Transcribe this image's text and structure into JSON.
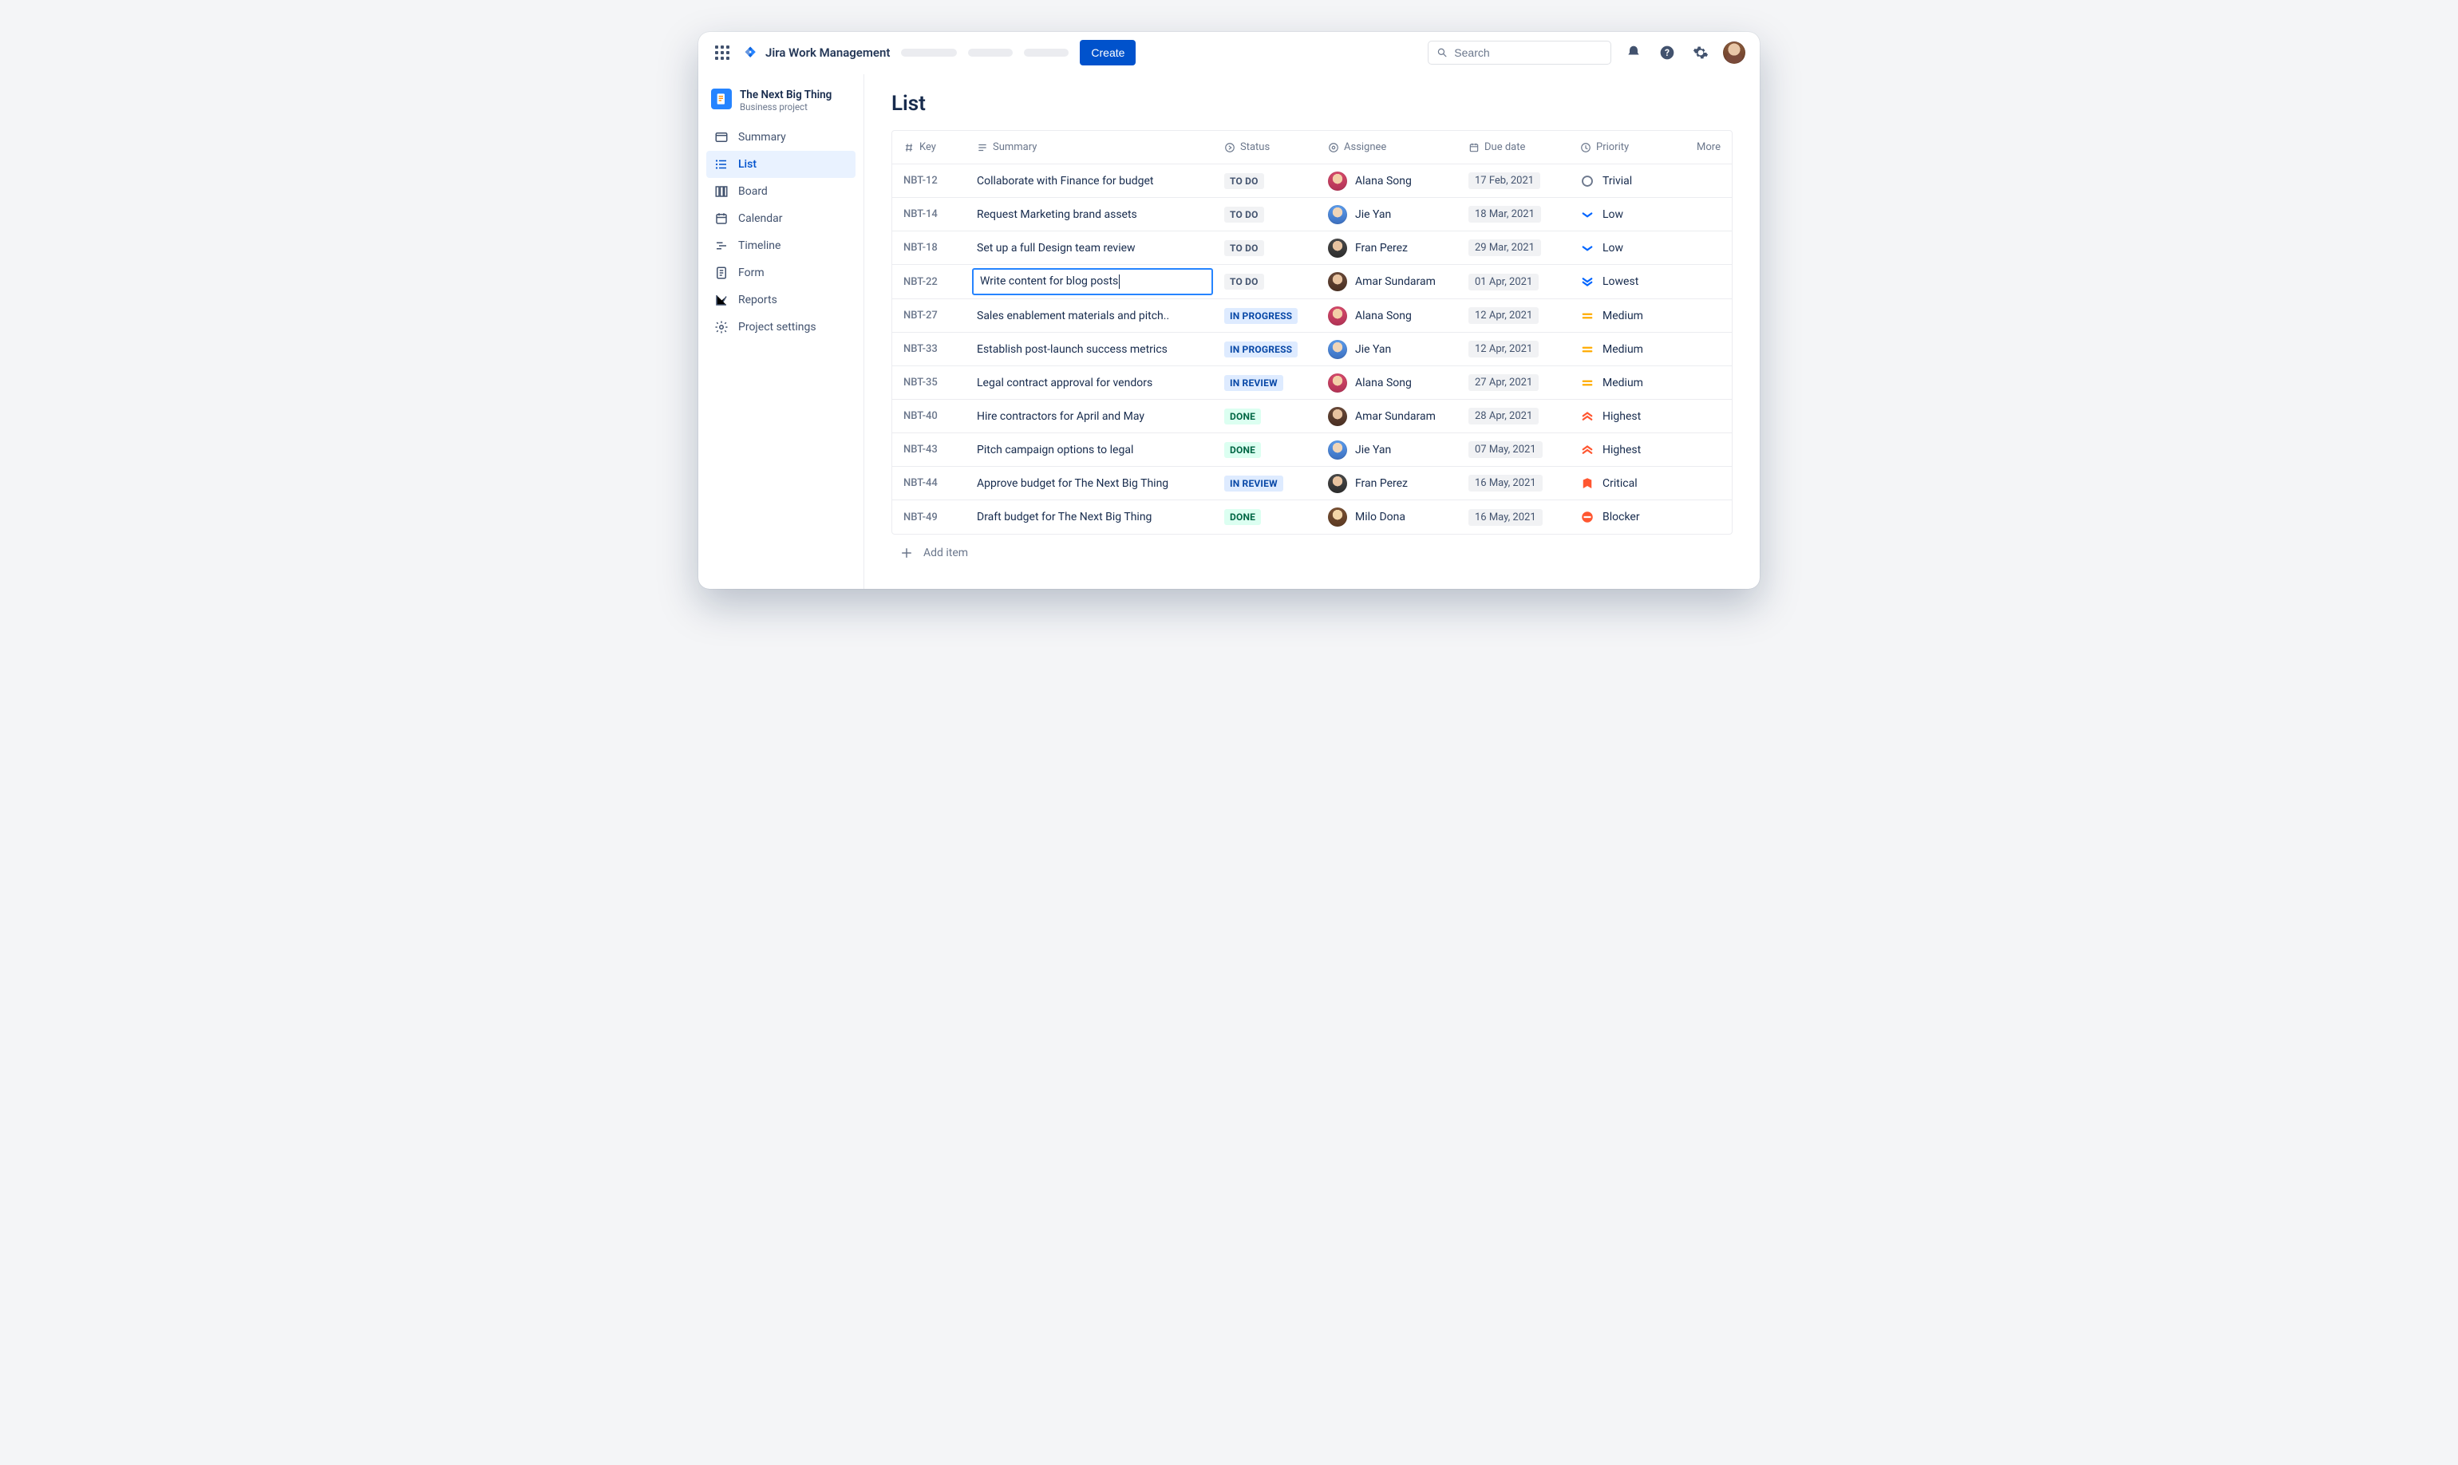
{
  "header": {
    "product": "Jira Work Management",
    "create_label": "Create",
    "search_placeholder": "Search"
  },
  "project": {
    "name": "The Next Big Thing",
    "type": "Business project"
  },
  "sidebar": {
    "items": [
      {
        "label": "Summary",
        "icon": "summary"
      },
      {
        "label": "List",
        "icon": "list",
        "active": true
      },
      {
        "label": "Board",
        "icon": "board"
      },
      {
        "label": "Calendar",
        "icon": "calendar"
      },
      {
        "label": "Timeline",
        "icon": "timeline"
      },
      {
        "label": "Form",
        "icon": "form"
      },
      {
        "label": "Reports",
        "icon": "reports"
      },
      {
        "label": "Project settings",
        "icon": "settings"
      }
    ]
  },
  "page": {
    "title": "List",
    "add_item": "Add item"
  },
  "columns": {
    "key": "Key",
    "summary": "Summary",
    "status": "Status",
    "assignee": "Assignee",
    "due": "Due date",
    "priority": "Priority",
    "more": "More"
  },
  "statuses": {
    "todo": "TO DO",
    "progress": "IN PROGRESS",
    "review": "IN REVIEW",
    "done": "DONE"
  },
  "priorities": {
    "trivial": "Trivial",
    "low": "Low",
    "lowest": "Lowest",
    "medium": "Medium",
    "highest": "Highest",
    "critical": "Critical",
    "blocker": "Blocker"
  },
  "rows": [
    {
      "key": "NBT-12",
      "summary": "Collaborate with Finance for budget",
      "status": "todo",
      "assignee": "Alana Song",
      "avatar": "a",
      "due": "17 Feb, 2021",
      "priority": "trivial"
    },
    {
      "key": "NBT-14",
      "summary": "Request Marketing brand assets",
      "status": "todo",
      "assignee": "Jie Yan",
      "avatar": "b",
      "due": "18 Mar, 2021",
      "priority": "low"
    },
    {
      "key": "NBT-18",
      "summary": "Set up a full Design team review",
      "status": "todo",
      "assignee": "Fran Perez",
      "avatar": "c",
      "due": "29 Mar, 2021",
      "priority": "low"
    },
    {
      "key": "NBT-22",
      "summary": "Write content for blog posts",
      "status": "todo",
      "assignee": "Amar Sundaram",
      "avatar": "d",
      "due": "01 Apr, 2021",
      "priority": "lowest",
      "editing": true
    },
    {
      "key": "NBT-27",
      "summary": "Sales enablement materials and pitch..",
      "status": "progress",
      "assignee": "Alana Song",
      "avatar": "a",
      "due": "12 Apr, 2021",
      "priority": "medium"
    },
    {
      "key": "NBT-33",
      "summary": "Establish post-launch success metrics",
      "status": "progress",
      "assignee": "Jie Yan",
      "avatar": "b",
      "due": "12 Apr, 2021",
      "priority": "medium"
    },
    {
      "key": "NBT-35",
      "summary": "Legal contract approval for vendors",
      "status": "review",
      "assignee": "Alana Song",
      "avatar": "a",
      "due": "27 Apr, 2021",
      "priority": "medium"
    },
    {
      "key": "NBT-40",
      "summary": "Hire contractors for April and May",
      "status": "done",
      "assignee": "Amar Sundaram",
      "avatar": "d",
      "due": "28 Apr, 2021",
      "priority": "highest"
    },
    {
      "key": "NBT-43",
      "summary": "Pitch campaign options to legal",
      "status": "done",
      "assignee": "Jie Yan",
      "avatar": "b",
      "due": "07 May, 2021",
      "priority": "highest"
    },
    {
      "key": "NBT-44",
      "summary": "Approve budget for The Next Big Thing",
      "status": "review",
      "assignee": "Fran Perez",
      "avatar": "c",
      "due": "16 May, 2021",
      "priority": "critical"
    },
    {
      "key": "NBT-49",
      "summary": "Draft budget for The Next Big Thing",
      "status": "done",
      "assignee": "Milo Dona",
      "avatar": "e",
      "due": "16 May, 2021",
      "priority": "blocker"
    }
  ]
}
